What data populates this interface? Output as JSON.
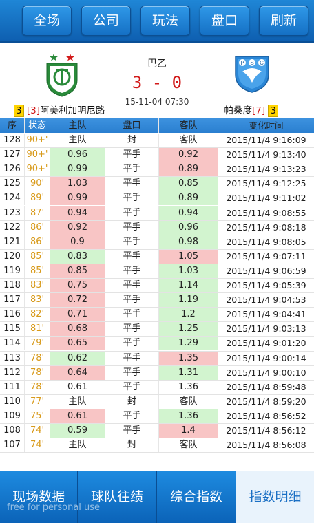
{
  "toolbar": [
    "全场",
    "公司",
    "玩法",
    "盘口",
    "刷新"
  ],
  "match": {
    "league": "巴乙",
    "score": "3 - 0",
    "time": "15-11-04 07:30",
    "home": {
      "rank_yellow": "3",
      "rank_red": "[3]",
      "name": "阿美利加明尼路"
    },
    "away": {
      "name": "帕桑度",
      "rank_red": "[7]",
      "rank_yellow": "3"
    }
  },
  "table": {
    "headers": [
      "序",
      "状态",
      "主队",
      "盘口",
      "客队",
      "变化时间"
    ],
    "rows": [
      {
        "no": "128",
        "status": "90+'",
        "home": "主队",
        "line": "封",
        "away": "客队",
        "time": "2015/11/4 9:16:09",
        "hc": "",
        "ac": ""
      },
      {
        "no": "127",
        "status": "90+'",
        "home": "0.96",
        "line": "平手",
        "away": "0.92",
        "time": "2015/11/4 9:13:40",
        "hc": "dn",
        "ac": "up"
      },
      {
        "no": "126",
        "status": "90+'",
        "home": "0.99",
        "line": "平手",
        "away": "0.89",
        "time": "2015/11/4 9:13:23",
        "hc": "dn",
        "ac": "up"
      },
      {
        "no": "125",
        "status": "90'",
        "home": "1.03",
        "line": "平手",
        "away": "0.85",
        "time": "2015/11/4 9:12:25",
        "hc": "up",
        "ac": "dn"
      },
      {
        "no": "124",
        "status": "89'",
        "home": "0.99",
        "line": "平手",
        "away": "0.89",
        "time": "2015/11/4 9:11:02",
        "hc": "up",
        "ac": "dn"
      },
      {
        "no": "123",
        "status": "87'",
        "home": "0.94",
        "line": "平手",
        "away": "0.94",
        "time": "2015/11/4 9:08:55",
        "hc": "up",
        "ac": "dn"
      },
      {
        "no": "122",
        "status": "86'",
        "home": "0.92",
        "line": "平手",
        "away": "0.96",
        "time": "2015/11/4 9:08:18",
        "hc": "up",
        "ac": "dn"
      },
      {
        "no": "121",
        "status": "86'",
        "home": "0.9",
        "line": "平手",
        "away": "0.98",
        "time": "2015/11/4 9:08:05",
        "hc": "up",
        "ac": "dn"
      },
      {
        "no": "120",
        "status": "85'",
        "home": "0.83",
        "line": "平手",
        "away": "1.05",
        "time": "2015/11/4 9:07:11",
        "hc": "dn",
        "ac": "up"
      },
      {
        "no": "119",
        "status": "85'",
        "home": "0.85",
        "line": "平手",
        "away": "1.03",
        "time": "2015/11/4 9:06:59",
        "hc": "up",
        "ac": "dn"
      },
      {
        "no": "118",
        "status": "83'",
        "home": "0.75",
        "line": "平手",
        "away": "1.14",
        "time": "2015/11/4 9:05:39",
        "hc": "up",
        "ac": "dn"
      },
      {
        "no": "117",
        "status": "83'",
        "home": "0.72",
        "line": "平手",
        "away": "1.19",
        "time": "2015/11/4 9:04:53",
        "hc": "up",
        "ac": "dn"
      },
      {
        "no": "116",
        "status": "82'",
        "home": "0.71",
        "line": "平手",
        "away": "1.2",
        "time": "2015/11/4 9:04:41",
        "hc": "up",
        "ac": "dn"
      },
      {
        "no": "115",
        "status": "81'",
        "home": "0.68",
        "line": "平手",
        "away": "1.25",
        "time": "2015/11/4 9:03:13",
        "hc": "up",
        "ac": "dn"
      },
      {
        "no": "114",
        "status": "79'",
        "home": "0.65",
        "line": "平手",
        "away": "1.29",
        "time": "2015/11/4 9:01:20",
        "hc": "up",
        "ac": "dn"
      },
      {
        "no": "113",
        "status": "78'",
        "home": "0.62",
        "line": "平手",
        "away": "1.35",
        "time": "2015/11/4 9:00:14",
        "hc": "dn",
        "ac": "up"
      },
      {
        "no": "112",
        "status": "78'",
        "home": "0.64",
        "line": "平手",
        "away": "1.31",
        "time": "2015/11/4 9:00:10",
        "hc": "up",
        "ac": "dn"
      },
      {
        "no": "111",
        "status": "78'",
        "home": "0.61",
        "line": "平手",
        "away": "1.36",
        "time": "2015/11/4 8:59:48",
        "hc": "",
        "ac": ""
      },
      {
        "no": "110",
        "status": "77'",
        "home": "主队",
        "line": "封",
        "away": "客队",
        "time": "2015/11/4 8:59:20",
        "hc": "",
        "ac": ""
      },
      {
        "no": "109",
        "status": "75'",
        "home": "0.61",
        "line": "平手",
        "away": "1.36",
        "time": "2015/11/4 8:56:52",
        "hc": "up",
        "ac": "dn"
      },
      {
        "no": "108",
        "status": "74'",
        "home": "0.59",
        "line": "平手",
        "away": "1.4",
        "time": "2015/11/4 8:56:12",
        "hc": "dn",
        "ac": "up"
      },
      {
        "no": "107",
        "status": "74'",
        "home": "主队",
        "line": "封",
        "away": "客队",
        "time": "2015/11/4 8:56:08",
        "hc": "",
        "ac": ""
      }
    ]
  },
  "bottom_tabs": [
    {
      "label": "现场数据",
      "active": false
    },
    {
      "label": "球队往绩",
      "active": false
    },
    {
      "label": "综合指数",
      "active": false
    },
    {
      "label": "指数明细",
      "active": true
    }
  ],
  "watermark": "free for personal use",
  "colors": {
    "accent": "#1570c4",
    "up": "#f8c5c5",
    "down": "#d2f4cf",
    "score": "#d21a1a",
    "minute": "#d89a1a"
  }
}
